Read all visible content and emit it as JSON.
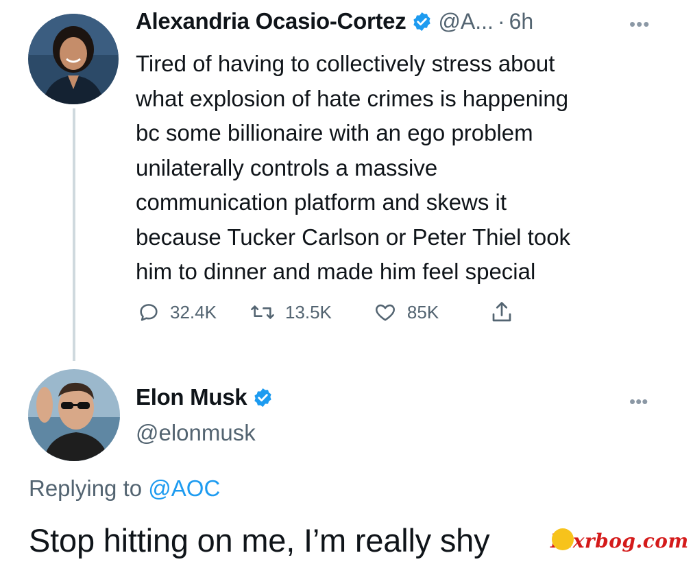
{
  "tweet1": {
    "author_name": "Alexandria Ocasio-Cortez",
    "handle": "@A...",
    "separator": "·",
    "time": "6h",
    "more_icon": "more-horizontal-icon",
    "verified_icon": "verified-badge-icon",
    "body_lines": [
      "Tired of having to collectively stress about",
      "what explosion of hate crimes is happening",
      "bc some billionaire with an ego problem",
      "unilaterally controls a massive",
      "communication platform and skews it",
      "because Tucker Carlson or Peter Thiel took",
      "him to dinner and made him feel special"
    ],
    "actions": {
      "replies": "32.4K",
      "retweets": "13.5K",
      "likes": "85K"
    }
  },
  "tweet2": {
    "author_name": "Elon Musk",
    "handle": "@elonmusk",
    "replying_prefix": "Replying to",
    "replying_to": "@AOC",
    "body": "Stop hitting on me, I’m really shy"
  },
  "watermark": "Pixrbog.com",
  "colors": {
    "text": "#0f1419",
    "secondary": "#536471",
    "accent": "#1d9bf0",
    "thread_line": "#cfd9de",
    "watermark": "#d41a1a"
  }
}
